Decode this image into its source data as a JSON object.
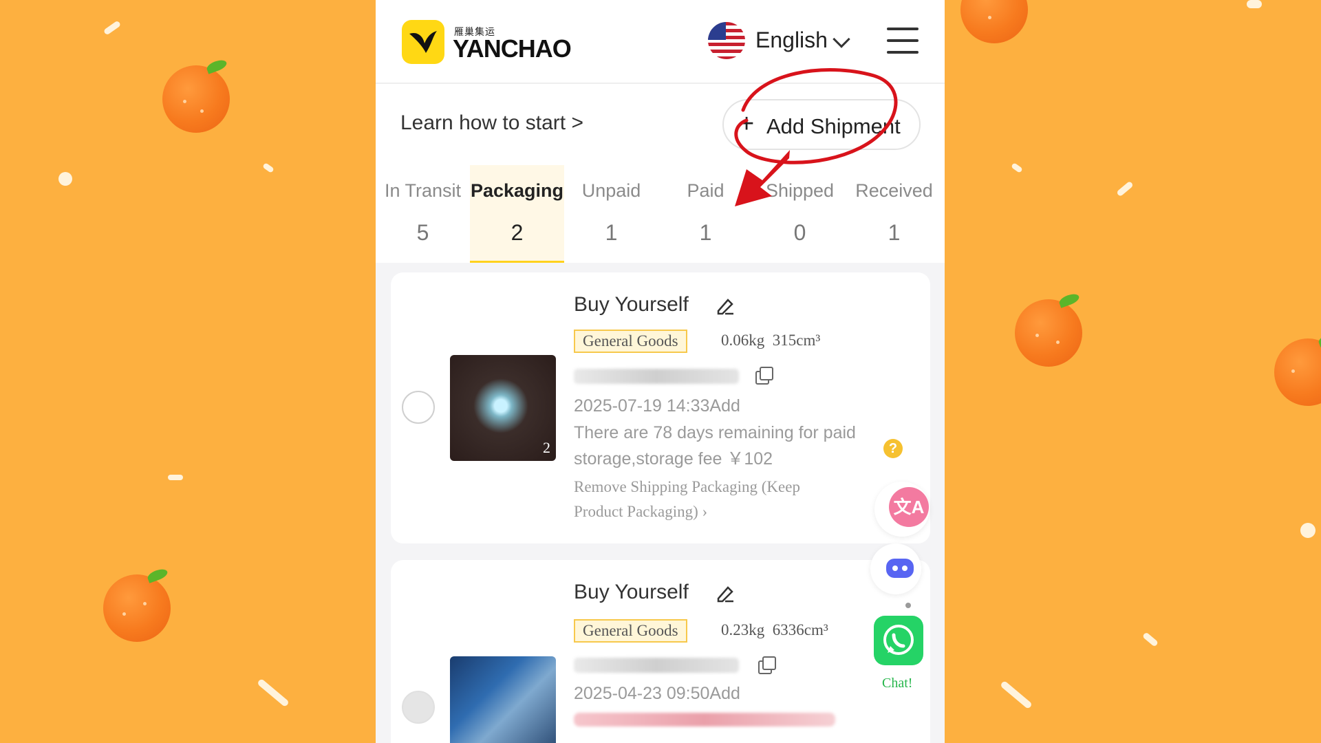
{
  "header": {
    "logo_sub": "雁巢集运",
    "logo_name": "YANCHAO",
    "language": "English",
    "menu_icon": "hamburger-menu-icon"
  },
  "toolbar": {
    "learn_link": "Learn how to start >",
    "add_plus": "+",
    "add_label": "Add Shipment"
  },
  "tabs": [
    {
      "label": "In Transit",
      "count": "5"
    },
    {
      "label": "Packaging",
      "count": "2",
      "active": true
    },
    {
      "label": "Unpaid",
      "count": "1"
    },
    {
      "label": "Paid",
      "count": "1"
    },
    {
      "label": "Shipped",
      "count": "0"
    },
    {
      "label": "Received",
      "count": "1"
    }
  ],
  "cards": [
    {
      "title": "Buy Yourself",
      "tag": "General Goods",
      "weight": "0.06kg",
      "volume": "315cm³",
      "date": "2025-07-19 14:33Add",
      "note": "There are 78 days remaining for paid storage,storage fee ￥102",
      "action": "Remove Shipping Packaging (Keep Product Packaging)",
      "image_count": "2",
      "help_icon": "?"
    },
    {
      "title": "Buy Yourself",
      "tag": "General Goods",
      "weight": "0.23kg",
      "volume": "6336cm³",
      "date": "2025-04-23 09:50Add"
    }
  ],
  "side": {
    "translate_icon": "文A",
    "chat_label": "Chat!"
  },
  "colors": {
    "background": "#fdb040",
    "brand_yellow": "#ffd814",
    "tab_active_bg": "#fff8e6",
    "annotation_red": "#d8131b",
    "whatsapp_green": "#25d366"
  }
}
